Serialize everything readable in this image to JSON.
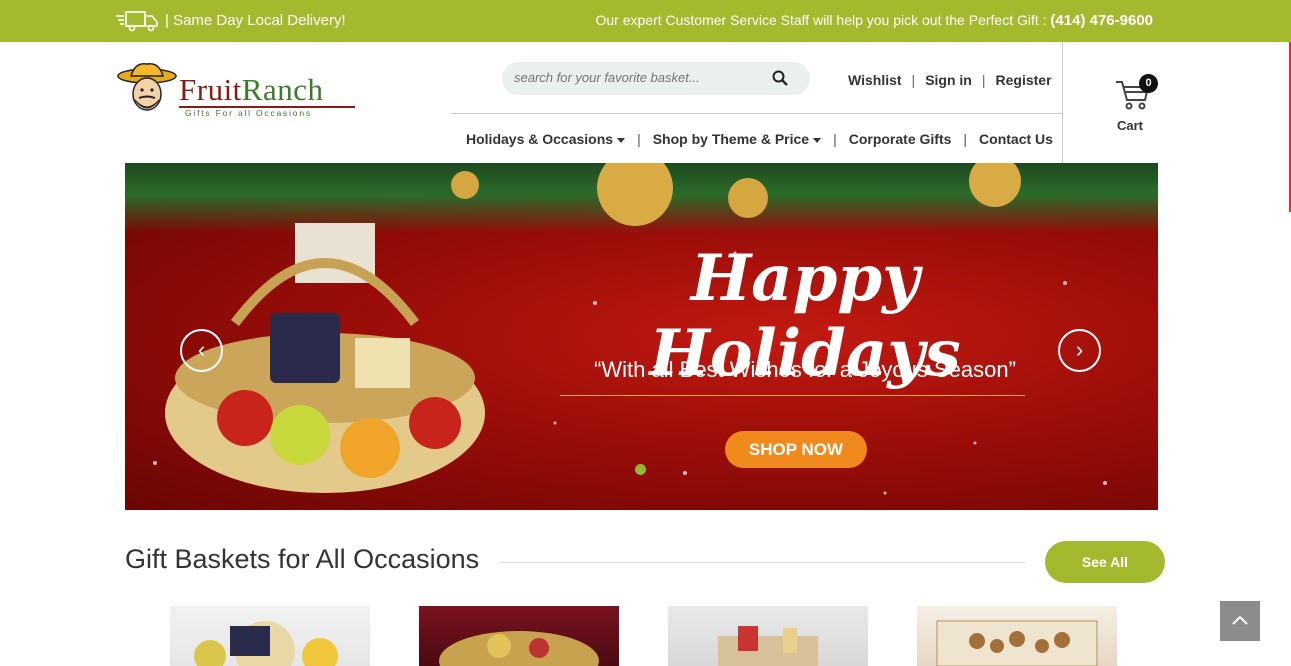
{
  "topbar": {
    "delivery": "| Same Day Local Delivery!",
    "service_text": "Our expert Customer Service Staff will help you pick out the Perfect Gift : ",
    "phone": "(414) 476-9600",
    "bg_color": "#a5b92e"
  },
  "logo": {
    "name_part1": "Fruit",
    "name_part2": "Ranch",
    "tagline": "Gifts For all Occasions"
  },
  "search": {
    "placeholder": "search for your favorite basket..."
  },
  "account": {
    "wishlist": "Wishlist",
    "signin": "Sign in",
    "register": "Register",
    "sep": "|"
  },
  "nav": {
    "items": [
      {
        "label": "Holidays & Occasions"
      },
      {
        "label": "Shop by Theme & Price"
      },
      {
        "label": "Corporate Gifts"
      },
      {
        "label": "Contact Us"
      }
    ],
    "sep": "|"
  },
  "cart": {
    "count": "0",
    "label": "Cart"
  },
  "hero": {
    "headline": "Happy Holidays",
    "subline": "“With all Best Wishes for a Joyous Season”",
    "cta": "SHOP NOW",
    "prev_icon": "‹",
    "next_icon": "›",
    "accent_color": "#f08a1c"
  },
  "section": {
    "title": "Gift Baskets for All Occasions",
    "see_all": "See All"
  },
  "back_to_top": {
    "icon": "chevron-up-icon"
  }
}
